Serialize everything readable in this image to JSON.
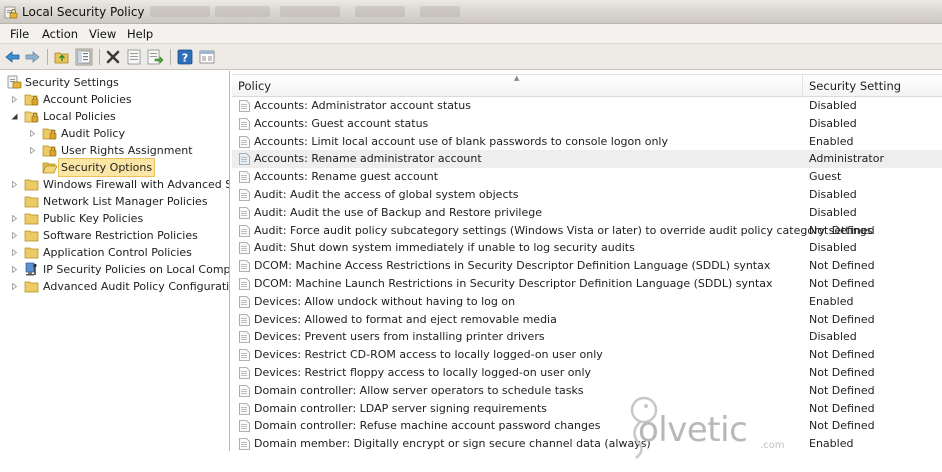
{
  "window": {
    "title": "Local Security Policy"
  },
  "menu": [
    "File",
    "Action",
    "View",
    "Help"
  ],
  "toolbar": {
    "buttons": [
      "back-arrow-icon",
      "forward-arrow-icon",
      "up-folder-icon",
      "show-hide-tree-icon",
      "delete-icon",
      "properties-icon",
      "export-list-icon",
      "help-icon",
      "view-icon"
    ]
  },
  "tree": {
    "root": "Security Settings",
    "items": [
      {
        "label": "Account Policies"
      },
      {
        "label": "Local Policies"
      },
      {
        "label": "Audit Policy"
      },
      {
        "label": "User Rights Assignment"
      },
      {
        "label": "Security Options"
      },
      {
        "label": "Windows Firewall with Advanced Secu"
      },
      {
        "label": "Network List Manager Policies"
      },
      {
        "label": "Public Key Policies"
      },
      {
        "label": "Software Restriction Policies"
      },
      {
        "label": "Application Control Policies"
      },
      {
        "label": "IP Security Policies on Local Compute"
      },
      {
        "label": "Advanced Audit Policy Configuration"
      }
    ]
  },
  "list": {
    "columns": {
      "policy": "Policy",
      "setting": "Security Setting"
    },
    "rows": [
      {
        "policy": "Accounts: Administrator account status",
        "setting": "Disabled"
      },
      {
        "policy": "Accounts: Guest account status",
        "setting": "Disabled"
      },
      {
        "policy": "Accounts: Limit local account use of blank passwords to console logon only",
        "setting": "Enabled"
      },
      {
        "policy": "Accounts: Rename administrator account",
        "setting": "Administrator"
      },
      {
        "policy": "Accounts: Rename guest account",
        "setting": "Guest"
      },
      {
        "policy": "Audit: Audit the access of global system objects",
        "setting": "Disabled"
      },
      {
        "policy": "Audit: Audit the use of Backup and Restore privilege",
        "setting": "Disabled"
      },
      {
        "policy": "Audit: Force audit policy subcategory settings (Windows Vista or later) to override audit policy category settings",
        "setting": "Not Defined"
      },
      {
        "policy": "Audit: Shut down system immediately if unable to log security audits",
        "setting": "Disabled"
      },
      {
        "policy": "DCOM: Machine Access Restrictions in Security Descriptor Definition Language (SDDL) syntax",
        "setting": "Not Defined"
      },
      {
        "policy": "DCOM: Machine Launch Restrictions in Security Descriptor Definition Language (SDDL) syntax",
        "setting": "Not Defined"
      },
      {
        "policy": "Devices: Allow undock without having to log on",
        "setting": "Enabled"
      },
      {
        "policy": "Devices: Allowed to format and eject removable media",
        "setting": "Not Defined"
      },
      {
        "policy": "Devices: Prevent users from installing printer drivers",
        "setting": "Disabled"
      },
      {
        "policy": "Devices: Restrict CD-ROM access to locally logged-on user only",
        "setting": "Not Defined"
      },
      {
        "policy": "Devices: Restrict floppy access to locally logged-on user only",
        "setting": "Not Defined"
      },
      {
        "policy": "Domain controller: Allow server operators to schedule tasks",
        "setting": "Not Defined"
      },
      {
        "policy": "Domain controller: LDAP server signing requirements",
        "setting": "Not Defined"
      },
      {
        "policy": "Domain controller: Refuse machine account password changes",
        "setting": "Not Defined"
      },
      {
        "policy": "Domain member: Digitally encrypt or sign secure channel data (always)",
        "setting": "Enabled"
      }
    ]
  },
  "watermark": {
    "text": "olvetic",
    "suffix": ".com"
  },
  "colors": {
    "selection": "#fbe6a6",
    "folder": "#e8c25c",
    "row_highlight": "#eeeeee"
  }
}
